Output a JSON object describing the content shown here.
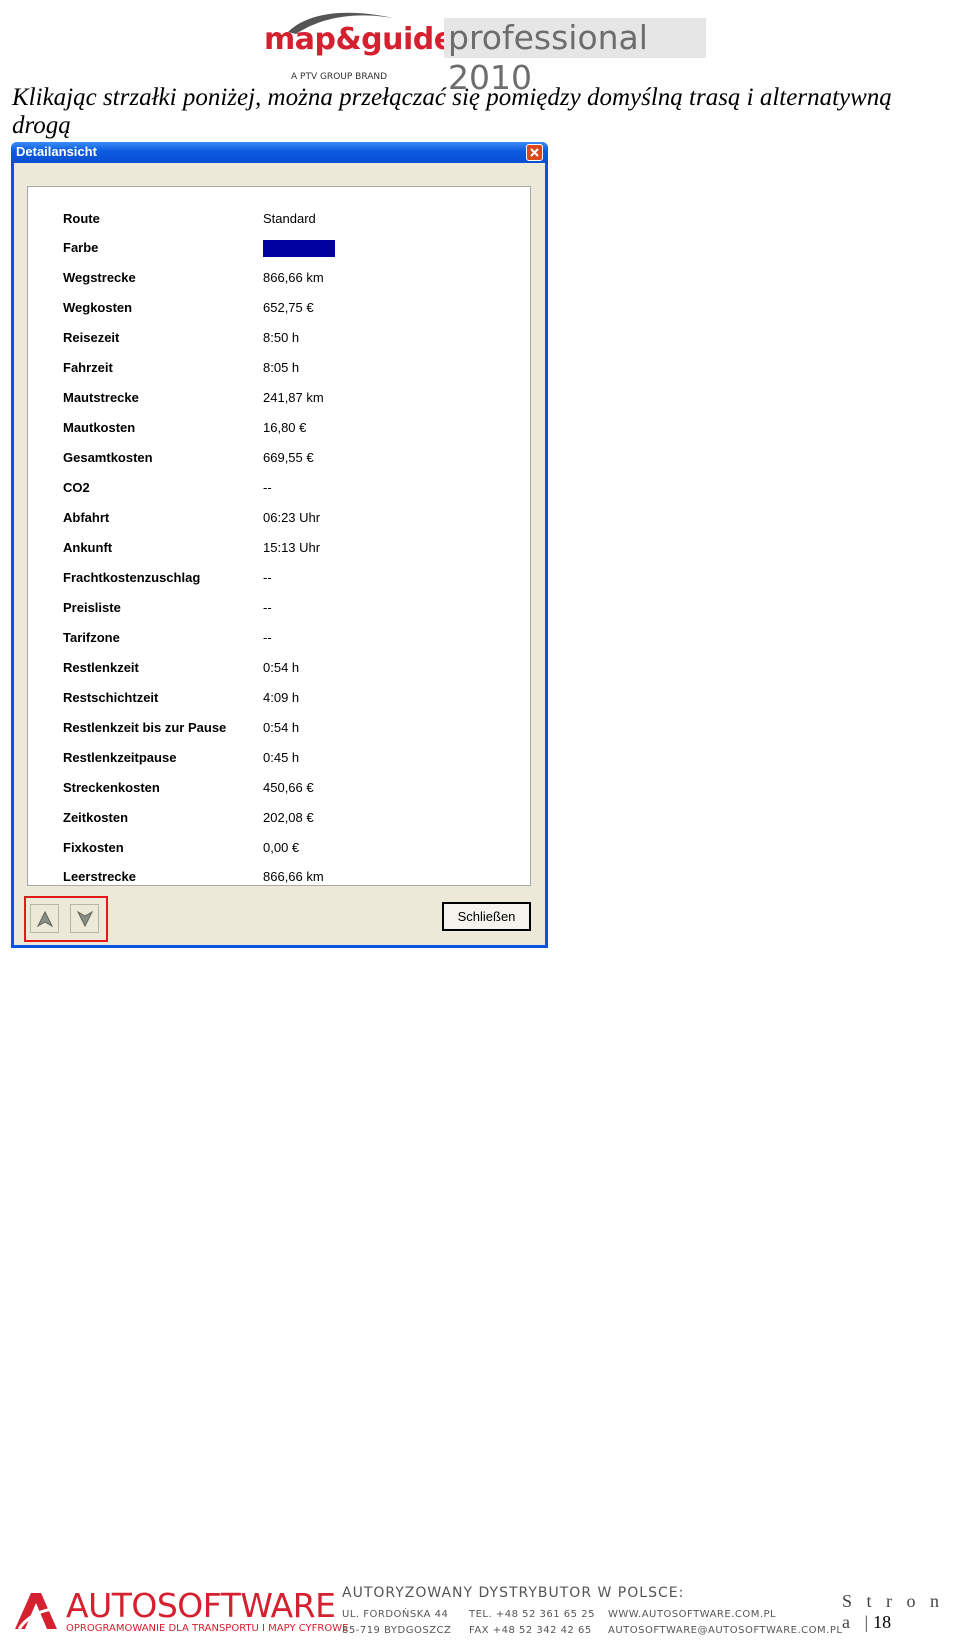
{
  "header": {
    "logo_text": "map&guide",
    "logo_tagline": "A PTV GROUP BRAND",
    "product": "professional 2010"
  },
  "intro_text": "Klikając strzałki poniżej, można przełączać się pomiędzy domyślną trasą i alternatywną drogą",
  "window": {
    "title": "Detailansicht",
    "close_button_label": "Schließen",
    "rows": [
      {
        "label": "Route",
        "value": "Standard"
      },
      {
        "label": "Farbe",
        "value": ""
      },
      {
        "label": "Wegstrecke",
        "value": "866,66 km"
      },
      {
        "label": "Wegkosten",
        "value": "652,75 €"
      },
      {
        "label": "Reisezeit",
        "value": "8:50 h"
      },
      {
        "label": "Fahrzeit",
        "value": "8:05 h"
      },
      {
        "label": "Mautstrecke",
        "value": "241,87 km"
      },
      {
        "label": "Mautkosten",
        "value": "16,80 €"
      },
      {
        "label": "Gesamtkosten",
        "value": "669,55 €"
      },
      {
        "label": "CO2",
        "value": "--"
      },
      {
        "label": "Abfahrt",
        "value": "06:23 Uhr"
      },
      {
        "label": "Ankunft",
        "value": "15:13 Uhr"
      },
      {
        "label": "Frachtkostenzuschlag",
        "value": "--"
      },
      {
        "label": "Preisliste",
        "value": "--"
      },
      {
        "label": "Tarifzone",
        "value": "--"
      },
      {
        "label": "Restlenkzeit",
        "value": "0:54 h"
      },
      {
        "label": "Restschichtzeit",
        "value": "4:09 h"
      },
      {
        "label": "Restlenkzeit bis zur Pause",
        "value": "0:54 h"
      },
      {
        "label": "Restlenkzeitpause",
        "value": "0:45 h"
      },
      {
        "label": "Streckenkosten",
        "value": "450,66 €"
      },
      {
        "label": "Zeitkosten",
        "value": "202,08 €"
      },
      {
        "label": "Fixkosten",
        "value": "0,00 €"
      },
      {
        "label": "Leerstrecke",
        "value": "866,66 km"
      }
    ],
    "route_color": "#00009f"
  },
  "footer": {
    "brand": "AUTOSOFTWARE",
    "brand_sub": "OPROGRAMOWANIE DLA TRANSPORTU I MAPY CYFROWE",
    "heading": "AUTORYZOWANY DYSTRYBUTOR W POLSCE:",
    "street": "UL. FORDOŃSKA 44",
    "city": "85-719 BYDGOSZCZ",
    "tel": "TEL. +48 52 361 65 25",
    "fax": "FAX +48 52 342 42 65",
    "www": "WWW.AUTOSOFTWARE.COM.PL",
    "email": "AUTOSOFTWARE@AUTOSOFTWARE.COM.PL",
    "page_label": "S t r o n a |",
    "page_number": "18"
  }
}
